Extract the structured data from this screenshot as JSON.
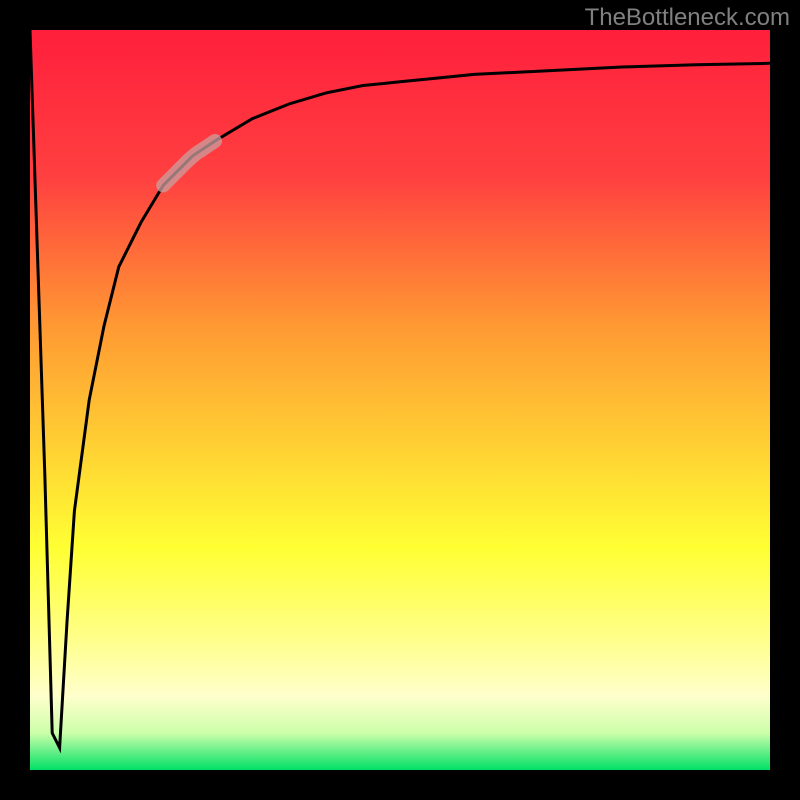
{
  "watermark": "TheBottleneck.com",
  "chart_data": {
    "type": "line",
    "title": "",
    "xlabel": "",
    "ylabel": "",
    "xlim": [
      0,
      100
    ],
    "ylim": [
      0,
      100
    ],
    "grid": false,
    "series": [
      {
        "name": "bottleneck-curve",
        "x": [
          0,
          2,
          3,
          4,
          5,
          6,
          8,
          10,
          12,
          15,
          18,
          20,
          22,
          25,
          30,
          35,
          40,
          45,
          50,
          55,
          60,
          70,
          80,
          90,
          100
        ],
        "y": [
          100,
          40,
          5,
          3,
          20,
          35,
          50,
          60,
          68,
          74,
          79,
          81,
          83,
          85,
          88,
          90,
          91.5,
          92.5,
          93,
          93.5,
          94,
          94.5,
          95,
          95.3,
          95.5
        ]
      }
    ],
    "highlight_segment": {
      "series": "bottleneck-curve",
      "x_range": [
        18,
        25
      ],
      "style": "thick-translucent"
    },
    "background_gradient": {
      "stops": [
        {
          "pos": 0.0,
          "color": "#ff1f3c"
        },
        {
          "pos": 0.2,
          "color": "#ff4040"
        },
        {
          "pos": 0.4,
          "color": "#ff9933"
        },
        {
          "pos": 0.55,
          "color": "#ffcc33"
        },
        {
          "pos": 0.7,
          "color": "#ffff33"
        },
        {
          "pos": 0.82,
          "color": "#ffff88"
        },
        {
          "pos": 0.9,
          "color": "#ffffcc"
        },
        {
          "pos": 0.95,
          "color": "#ccffaa"
        },
        {
          "pos": 1.0,
          "color": "#00e066"
        }
      ]
    },
    "frame": {
      "color": "#000000",
      "width": 30
    }
  }
}
